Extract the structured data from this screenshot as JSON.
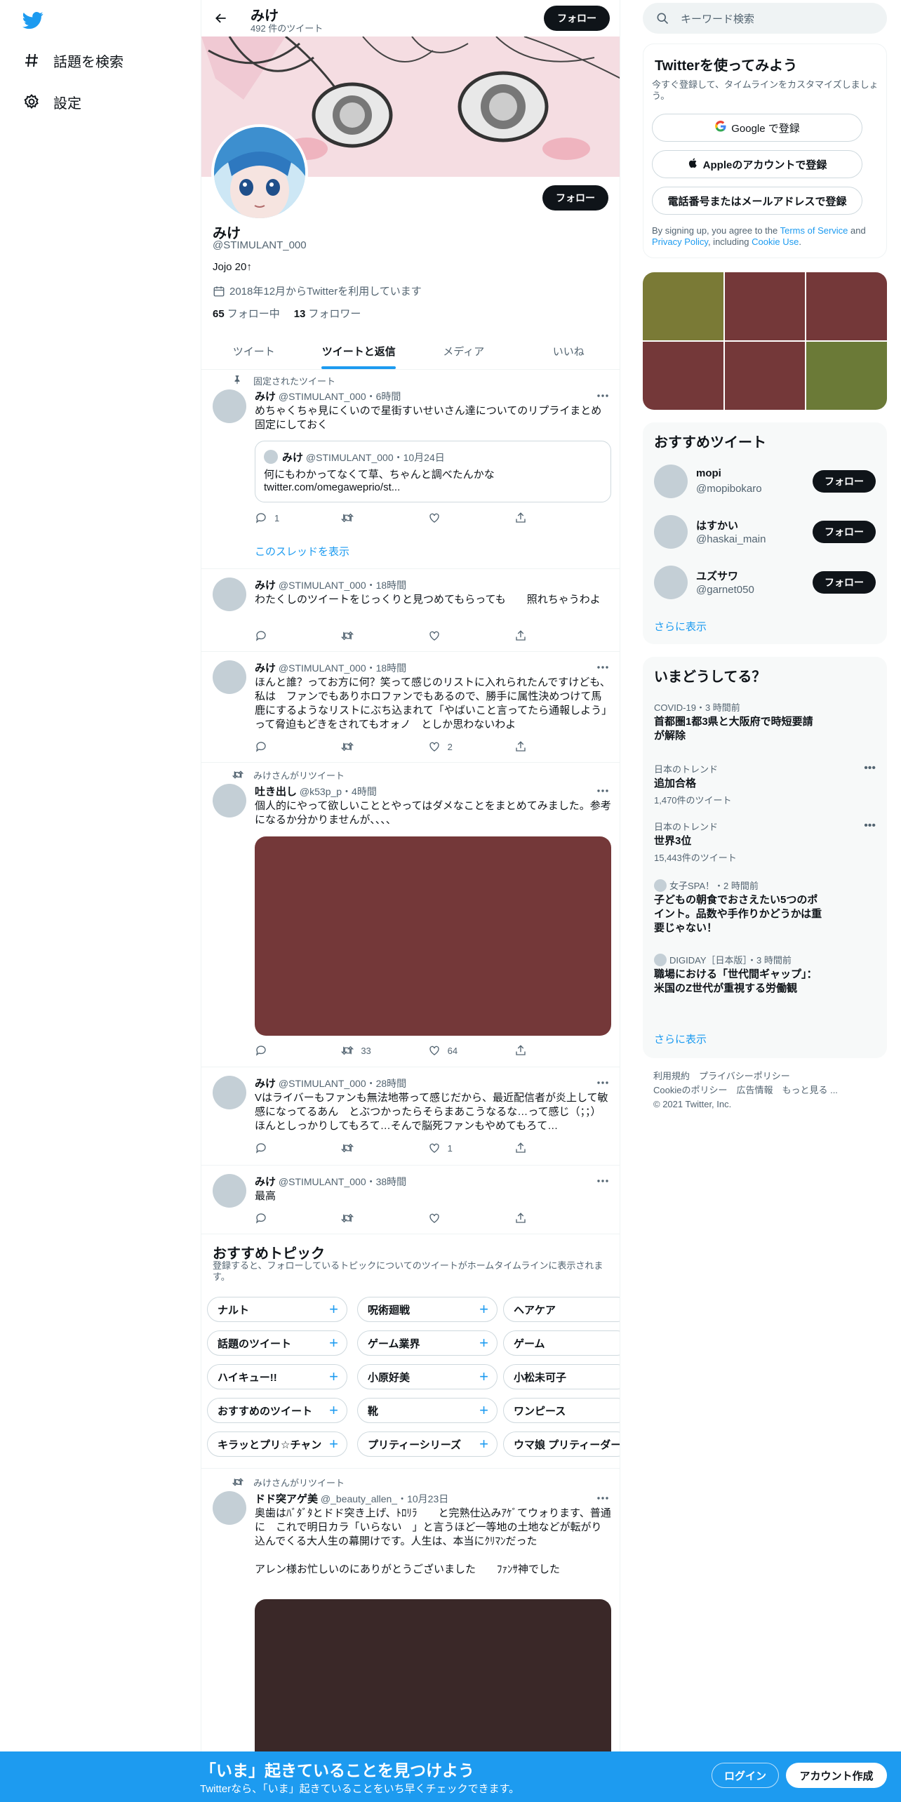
{
  "nav": {
    "explore": "話題を検索",
    "settings": "設定"
  },
  "header": {
    "name": "みけ",
    "tweet_count": "492 件のツイート",
    "follow": "フォロー"
  },
  "profile": {
    "follow": "フォロー",
    "name": "みけ",
    "handle": "@STIMULANT_000",
    "bio": "Jojo 20↑",
    "joined": "2018年12月からTwitterを利用しています",
    "following_count": "65",
    "following_label": "フォロー中",
    "followers_count": "13",
    "followers_label": "フォロワー"
  },
  "tabs": [
    "ツイート",
    "ツイートと返信",
    "メディア",
    "いいね"
  ],
  "tweets": [
    {
      "context": "固定されたツイート",
      "name": "みけ",
      "meta": "@STIMULANT_000・6時間",
      "text": "めちゃくちゃ見にくいので星街すいせいさん達についてのリプライまとめ固定にしておく",
      "quote": {
        "name": "みけ",
        "meta": "@STIMULANT_000・10月24日",
        "line1": "何にもわかってなくて草、ちゃんと調べたんかな",
        "line2": "twitter.com/omegaweprio/st..."
      },
      "reply": "1",
      "retweet": "",
      "like": "",
      "show_thread": "このスレッドを表示"
    },
    {
      "name": "みけ",
      "meta": "@STIMULANT_000・18時間",
      "text": "わたくしのツイートをじっくりと見つめてもらっても　　照れちゃうわよ",
      "reply": "",
      "retweet": "",
      "like": ""
    },
    {
      "name": "みけ",
      "meta": "@STIMULANT_000・18時間",
      "text": "ほんと誰？ってお方に何？笑って感じのリストに入れられたんですけども、私は　ファンでもありホロファンでもあるので、勝手に属性決めつけて馬鹿にするようなリストにぶち込まれて「やばいこと言ってたら通報しよう」って脅迫もどきをされてもオォノ　としか思わないわよ",
      "reply": "",
      "retweet": "",
      "like": "2"
    },
    {
      "context": "みけさんがリツイート",
      "name": "吐き出し",
      "meta": "@k53p_p・4時間",
      "text": "個人的にやって欲しいこととやってはダメなことをまとめてみました。参考になるか分かりませんが、、、、",
      "reply": "",
      "retweet": "33",
      "like": "64"
    },
    {
      "name": "みけ",
      "meta": "@STIMULANT_000・28時間",
      "text": "Vはライバーもファンも無法地帯って感じだから、最近配信者が炎上して敏感になってるあん　とぶつかったらそらまあこうなるな…って感じ（；；）ほんとしっかりしてもろて…そんで脳死ファンもやめてもろて…",
      "reply": "",
      "retweet": "",
      "like": "1"
    },
    {
      "name": "みけ",
      "meta": "@STIMULANT_000・38時間",
      "text": "最高",
      "reply": "",
      "retweet": "",
      "like": ""
    },
    {
      "context": "みけさんがリツイート",
      "name": "ドド突アゲ美",
      "meta": "@_beauty_allen_・10月23日",
      "text": "奥歯はﾊﾞﾀﾞﾀとドド突き上げ、ﾄﾛﾘﾗ　　と完熟仕込みｱｹﾞてウォります、普通に　これで明日カラ「いらない　」と言うほど一等地の土地などが転がり込んでくる大人生の幕開けです。人生は、本当にｸﾘﾏﾝだった",
      "text2": "アレン様お忙しいのにありがとうございました　　ﾌｧﾝｻ神でした"
    }
  ],
  "topics": {
    "title": "おすすめトピック",
    "subtitle": "登録すると、フォローしているトピックについてのツイートがホームタイムラインに表示されます。",
    "chips": [
      "ナルト",
      "呪術廻戦",
      "ヘアケア",
      "話題のツイート",
      "ゲーム業界",
      "ゲーム",
      "ハイキュー!!",
      "小原好美",
      "小松未可子",
      "おすすめのツイート",
      "靴",
      "ワンピース",
      "キラッとプリ☆チャン",
      "プリティーシリーズ",
      "ウマ娘 プリティーダービー"
    ]
  },
  "search": {
    "placeholder": "キーワード検索"
  },
  "signup": {
    "title": "Twitterを使ってみよう",
    "subtitle": "今すぐ登録して、タイムラインをカスタマイズしましょう。",
    "google": "Google で登録",
    "apple": "Appleのアカウントで登録",
    "phone": "電話番号またはメールアドレスで登録",
    "legal_pre": "By signing up, you agree to the ",
    "terms": "Terms of Service",
    "and": " and ",
    "privacy": "Privacy Policy",
    "including": ", including ",
    "cookie": "Cookie Use",
    "period": "."
  },
  "media_colors": [
    "#7a7a36",
    "#743839",
    "#743839",
    "#743839",
    "#743839",
    "#6b7a37"
  ],
  "who": {
    "title": "おすすめツイート",
    "users": [
      {
        "name": "mopi",
        "handle": "@mopibokaro",
        "button": "フォロー"
      },
      {
        "name": "はすかい",
        "handle": "@haskai_main",
        "button": "フォロー"
      },
      {
        "name": "ユズサワ",
        "handle": "@garnet050",
        "button": "フォロー"
      }
    ],
    "more": "さらに表示"
  },
  "trends": {
    "title": "いまどうしてる？",
    "items": [
      {
        "meta": "COVID-19・3 時間前",
        "title": "首都圏1都3県と大阪府で時短要請が解除"
      },
      {
        "meta": "日本のトレンド",
        "title": "追加合格",
        "count": "1,470件のツイート"
      },
      {
        "meta": "日本のトレンド",
        "title": "世界3位",
        "count": "15,443件のツイート"
      },
      {
        "meta": "女子SPA！・2 時間前",
        "title": "子どもの朝食でおさえたい5つのポイント。品数や手作りかどうかは重要じゃない！"
      },
      {
        "meta": "DIGIDAY［日本版］・3 時間前",
        "title": "職場における「世代間ギャップ」：米国のZ世代が重視する労働観"
      }
    ],
    "more": "さらに表示"
  },
  "footer": {
    "line1": "利用規約　プライバシーポリシー",
    "line2": "Cookieのポリシー　広告情報　もっと見る ...",
    "line3": "© 2021 Twitter, Inc."
  },
  "bottombar": {
    "title": "「いま」起きていることを見つけよう",
    "subtitle": "Twitterなら、「いま」起きていることをいち早くチェックできます。",
    "login": "ログイン",
    "signup": "アカウント作成"
  },
  "colors": {
    "accent": "#1d9bf0",
    "dark": "#0f1419",
    "media_red": "#743839",
    "media_dark": "#3a2828"
  }
}
